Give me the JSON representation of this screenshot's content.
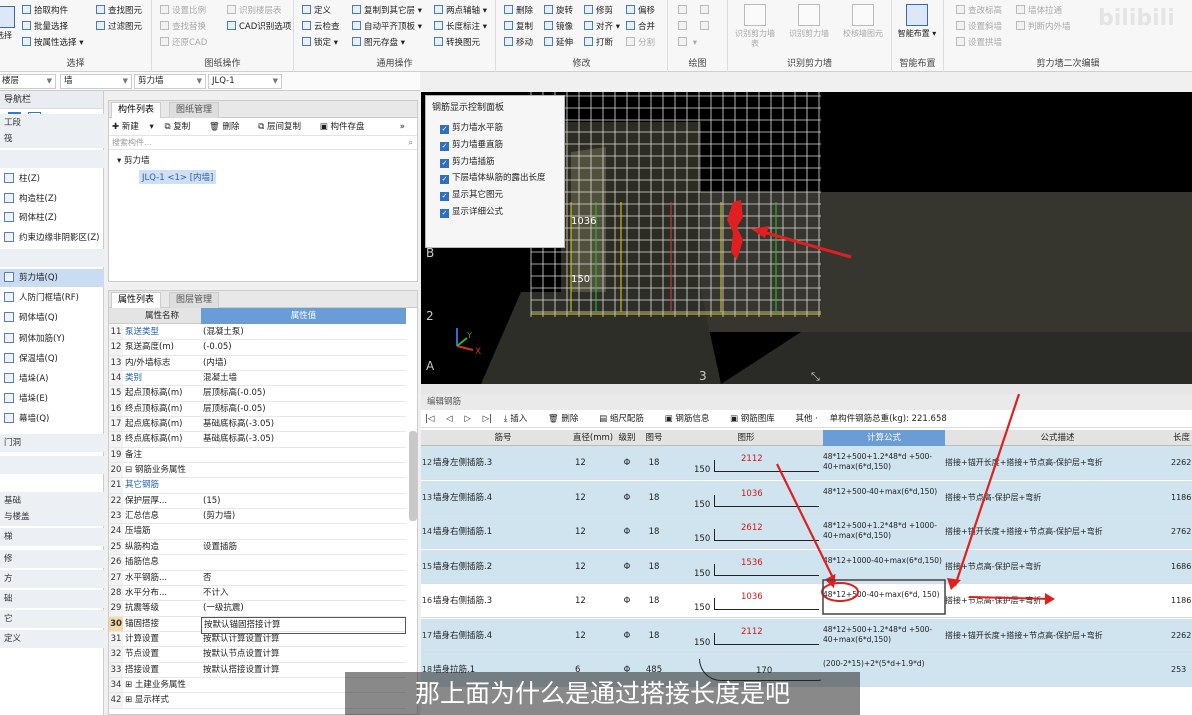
{
  "ribbon": {
    "select": {
      "label": "选择",
      "items": [
        "拾取构件",
        "批量选择",
        "按属性选择",
        "查找图元",
        "过滤图元"
      ],
      "big": "选择"
    },
    "drawing_ops": {
      "label": "图纸操作",
      "items": [
        "设置比例",
        "识别楼层表",
        "查找替换",
        "CAD识别选项",
        "还原CAD"
      ]
    },
    "general_ops": {
      "label": "通用操作",
      "items": [
        "定义",
        "复制到其它层",
        "两点辅轴",
        "云检查",
        "自动平齐顶板",
        "长度标注",
        "锁定",
        "图元存盘",
        "转换图元"
      ]
    },
    "modify": {
      "label": "修改",
      "items": [
        "删除",
        "旋转",
        "修剪",
        "偏移",
        "复制",
        "镜像",
        "对齐",
        "合并",
        "移动",
        "延伸",
        "打断",
        "分割"
      ]
    },
    "draw": {
      "label": "绘图"
    },
    "recognize_wall": {
      "label": "识别剪力墙",
      "items": [
        "识别剪力墙表",
        "识别剪力墙",
        "校核墙图元"
      ]
    },
    "smart": {
      "label": "智能布置",
      "items": [
        "智能布置"
      ]
    },
    "secondary": {
      "label": "剪力墙二次编辑",
      "items": [
        "查改标高",
        "墙体拉通",
        "设置斜墙",
        "判断内外墙",
        "设置拱墙"
      ]
    }
  },
  "propbar": {
    "floor": "楼层",
    "type": "墙",
    "subtype": "剪力墙",
    "component": "JLQ-1"
  },
  "nav": {
    "title": "导航栏",
    "items": [
      {
        "label": "工段",
        "kind": "cat"
      },
      {
        "label": "筏",
        "kind": "cat"
      },
      {
        "label": "",
        "kind": "cat"
      },
      {
        "label": "柱(Z)",
        "kind": "item"
      },
      {
        "label": "构造柱(Z)",
        "kind": "item"
      },
      {
        "label": "砌体柱(Z)",
        "kind": "item"
      },
      {
        "label": "约束边缘非阴影区(Z)",
        "kind": "item"
      },
      {
        "label": "",
        "kind": "cat"
      },
      {
        "label": "剪力墙(Q)",
        "kind": "sel"
      },
      {
        "label": "人防门框墙(RF)",
        "kind": "item"
      },
      {
        "label": "砌体墙(Q)",
        "kind": "item"
      },
      {
        "label": "砌体加筋(Y)",
        "kind": "item"
      },
      {
        "label": "保温墙(Q)",
        "kind": "item"
      },
      {
        "label": "墙垛(A)",
        "kind": "item"
      },
      {
        "label": "墙垛(E)",
        "kind": "item"
      },
      {
        "label": "幕墙(Q)",
        "kind": "item"
      },
      {
        "label": "门洞",
        "kind": "cat"
      },
      {
        "label": "",
        "kind": "cat"
      },
      {
        "label": "基础",
        "kind": "cat"
      },
      {
        "label": "与楼盖",
        "kind": "cat"
      },
      {
        "label": "梯",
        "kind": "cat"
      },
      {
        "label": "修",
        "kind": "cat"
      },
      {
        "label": "方",
        "kind": "cat"
      },
      {
        "label": "础",
        "kind": "cat"
      },
      {
        "label": "它",
        "kind": "cat"
      },
      {
        "label": "定义",
        "kind": "cat"
      }
    ]
  },
  "components": {
    "tabs": [
      "构件列表",
      "图纸管理"
    ],
    "toolbar": [
      "新建",
      "复制",
      "删除",
      "层间复制",
      "构件存盘"
    ],
    "search_placeholder": "搜索构件...",
    "tree_root": "剪力墙",
    "tree_item": "JLQ-1 <1> [内墙]"
  },
  "properties": {
    "tabs": [
      "属性列表",
      "图层管理"
    ],
    "headers": [
      "属性名称",
      "属性值"
    ],
    "rows": [
      {
        "n": "11",
        "name": "泵送类型",
        "value": "(混凝土泵)",
        "blue": true
      },
      {
        "n": "12",
        "name": "泵送高度(m)",
        "value": "(-0.05)"
      },
      {
        "n": "13",
        "name": "内/外墙标志",
        "value": "(内墙)"
      },
      {
        "n": "14",
        "name": "类别",
        "value": "混凝土墙",
        "blue": true
      },
      {
        "n": "15",
        "name": "起点顶标高(m)",
        "value": "层顶标高(-0.05)"
      },
      {
        "n": "16",
        "name": "终点顶标高(m)",
        "value": "层顶标高(-0.05)"
      },
      {
        "n": "17",
        "name": "起点底标高(m)",
        "value": "基础底标高(-3.05)"
      },
      {
        "n": "18",
        "name": "终点底标高(m)",
        "value": "基础底标高(-3.05)"
      },
      {
        "n": "19",
        "name": "备注",
        "value": ""
      },
      {
        "n": "20",
        "name": "⊟ 钢筋业务属性",
        "value": ""
      },
      {
        "n": "21",
        "name": "  其它钢筋",
        "value": "",
        "blue": true
      },
      {
        "n": "22",
        "name": "  保护层厚...",
        "value": "(15)"
      },
      {
        "n": "23",
        "name": "  汇总信息",
        "value": "(剪力墙)"
      },
      {
        "n": "24",
        "name": "  压墙筋",
        "value": ""
      },
      {
        "n": "25",
        "name": "  纵筋构造",
        "value": "设置插筋"
      },
      {
        "n": "26",
        "name": "  插筋信息",
        "value": ""
      },
      {
        "n": "27",
        "name": "  水平钢筋...",
        "value": "否"
      },
      {
        "n": "28",
        "name": "  水平分布...",
        "value": "不计入"
      },
      {
        "n": "29",
        "name": "  抗震等级",
        "value": "(一级抗震)"
      },
      {
        "n": "30",
        "name": "  锚固搭接",
        "value": "按默认锚固搭接计算",
        "sel": true
      },
      {
        "n": "31",
        "name": "  计算设置",
        "value": "按默认计算设置计算"
      },
      {
        "n": "32",
        "name": "  节点设置",
        "value": "按默认节点设置计算"
      },
      {
        "n": "33",
        "name": "  搭接设置",
        "value": "按默认搭接设置计算"
      },
      {
        "n": "34",
        "name": "⊞ 土建业务属性",
        "value": ""
      },
      {
        "n": "42",
        "name": "⊞ 显示样式",
        "value": ""
      }
    ]
  },
  "rebar_panel": {
    "title": "钢筋显示控制面板",
    "options": [
      "剪力墙水平筋",
      "剪力墙垂直筋",
      "剪力墙插筋",
      "下层墙体纵筋的露出长度",
      "显示其它图元",
      "显示详细公式"
    ]
  },
  "view": {
    "labels": [
      "1036",
      "150",
      "B",
      "2",
      "A",
      "3"
    ]
  },
  "edit": {
    "header": "编辑钢筋",
    "toolbar": [
      "插入",
      "删除",
      "缩尺配筋",
      "钢筋信息",
      "钢筋图库",
      "其他 ·",
      "单构件钢筋总重(kg): 221.658"
    ],
    "columns": [
      "筋号",
      "直径(mm)",
      "级别",
      "图号",
      "图形",
      "计算公式",
      "公式描述",
      "长度"
    ],
    "rows": [
      {
        "idx": "12",
        "name": "墙身左侧插筋.3",
        "dia": "12",
        "lv": "Φ",
        "code": "18",
        "left": "150",
        "val": "2112",
        "formula": "48*12+500+1.2*48*d +500-40+max(6*d,150)",
        "desc": "搭接+锚开长度+搭接+节点高-保护层+弯折",
        "len": "2262"
      },
      {
        "idx": "13",
        "name": "墙身左侧插筋.4",
        "dia": "12",
        "lv": "Φ",
        "code": "18",
        "left": "150",
        "val": "1036",
        "formula": "48*12+500-40+max(6*d,150)",
        "desc": "搭接+节点高-保护层+弯折",
        "len": "1186"
      },
      {
        "idx": "14",
        "name": "墙身右侧插筋.1",
        "dia": "12",
        "lv": "Φ",
        "code": "18",
        "left": "150",
        "val": "2612",
        "formula": "48*12+500+1.2*48*d +1000-40+max(6*d,150)",
        "desc": "搭接+锚开长度+搭接+节点高-保护层+弯折",
        "len": "2762"
      },
      {
        "idx": "15",
        "name": "墙身右侧插筋.2",
        "dia": "12",
        "lv": "Φ",
        "code": "18",
        "left": "150",
        "val": "1536",
        "formula": "48*12+1000-40+max(6*d,150)",
        "desc": "搭接+节点高-保护层+弯折",
        "len": "1686"
      },
      {
        "idx": "16",
        "name": "墙身右侧插筋.3",
        "dia": "12",
        "lv": "Φ",
        "code": "18",
        "left": "150",
        "val": "1036",
        "formula": "48*12+500-40+max(6*d, 150)",
        "desc": "搭接+节点高-保护层+弯折",
        "len": "1186",
        "cur": true
      },
      {
        "idx": "17",
        "name": "墙身右侧插筋.4",
        "dia": "12",
        "lv": "Φ",
        "code": "18",
        "left": "150",
        "val": "2112",
        "formula": "48*12+500+1.2*48*d +500-40+max(6*d,150)",
        "desc": "搭接+锚开长度+搭接+节点高-保护层+弯折",
        "len": "2262"
      },
      {
        "idx": "18",
        "name": "墙身拉筋.1",
        "dia": "6",
        "lv": "Φ",
        "code": "485",
        "left": "",
        "val": "170",
        "formula": "(200-2*15)+2*(5*d+1.9*d)",
        "desc": "",
        "len": "253"
      }
    ]
  },
  "subtitle": "那上面为什么是通过搭接长度是吧",
  "colors": {
    "accent": "#6a9cd6",
    "row_bg": "#cfe4ef",
    "annotation": "#e02020",
    "rebar_value": "#d01818"
  }
}
